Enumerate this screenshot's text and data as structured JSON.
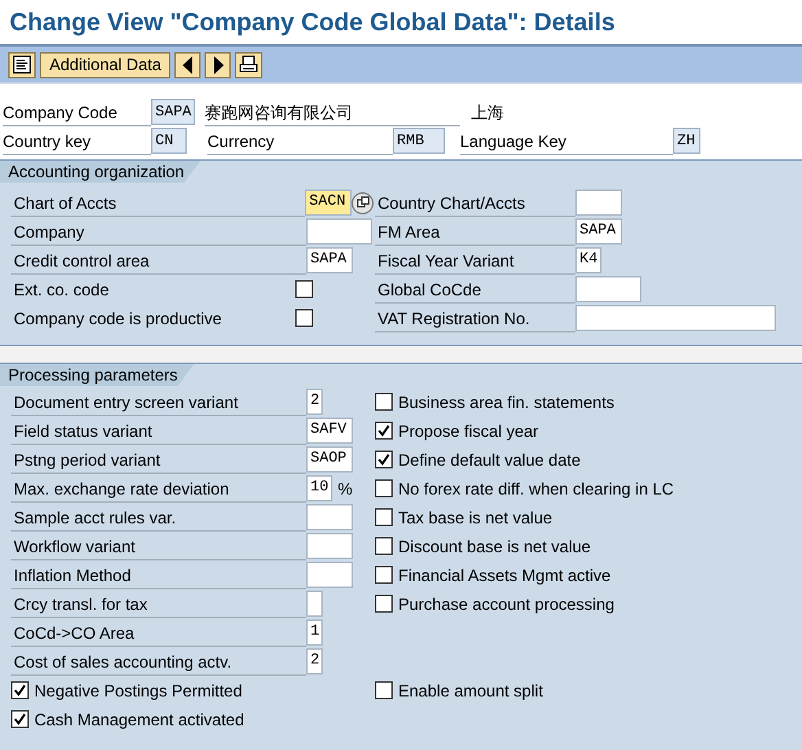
{
  "window": {
    "title": "Change View \"Company Code Global Data\": Details"
  },
  "toolbar": {
    "buttons": [
      {
        "kind": "icon"
      },
      {
        "kind": "text",
        "label": "Additional Data"
      },
      {
        "kind": "icon"
      },
      {
        "kind": "icon"
      },
      {
        "kind": "icon"
      }
    ]
  },
  "header": {
    "company_code": {
      "label": "Company Code",
      "value": "SAPA",
      "name": "赛跑网咨询有限公司",
      "city": "上海"
    },
    "country_key": {
      "label": "Country key",
      "value": "CN"
    },
    "currency": {
      "label": "Currency",
      "value": "RMB"
    },
    "language_key": {
      "label": "Language Key",
      "value": "ZH"
    }
  },
  "groups": [
    {
      "title": "Accounting organization",
      "rows": [
        {
          "left": {
            "kind": "field",
            "label": "Chart of Accts",
            "value": "SACN",
            "focused": true
          },
          "right": {
            "kind": "field",
            "label": "Country Chart/Accts"
          }
        },
        {
          "left": {
            "kind": "field",
            "label": "Company"
          },
          "right": {
            "kind": "field",
            "label": "FM Area",
            "value": "SAPA"
          }
        },
        {
          "left": {
            "kind": "field",
            "label": "Credit control area",
            "value": "SAPA"
          },
          "right": {
            "kind": "field",
            "label": "Fiscal Year Variant",
            "value": "K4"
          }
        },
        {
          "left": {
            "kind": "checkbox",
            "label": "Ext. co. code",
            "checked": false
          },
          "right": {
            "kind": "field",
            "label": "Global CoCde"
          }
        },
        {
          "left": {
            "kind": "checkbox",
            "label": "Company code is productive",
            "checked": false
          },
          "right": {
            "kind": "field",
            "label": "VAT Registration No."
          }
        }
      ]
    },
    {
      "title": "Processing parameters",
      "rows": [
        {
          "left": {
            "kind": "field",
            "label": "Document entry screen variant",
            "value": "2"
          },
          "right": {
            "kind": "check_first",
            "label": "Business area fin. statements",
            "checked": false
          }
        },
        {
          "left": {
            "kind": "field",
            "label": "Field status variant",
            "value": "SAFV"
          },
          "right": {
            "kind": "check_first",
            "label": "Propose fiscal year",
            "checked": true
          }
        },
        {
          "left": {
            "kind": "field",
            "label": "Pstng period variant",
            "value": "SAOP"
          },
          "right": {
            "kind": "check_first",
            "label": "Define default value date",
            "checked": true
          }
        },
        {
          "left": {
            "kind": "field",
            "label": "Max. exchange rate deviation",
            "value": "10",
            "unit": "%"
          },
          "right": {
            "kind": "check_first",
            "label": "No forex rate diff. when clearing in LC",
            "checked": false
          }
        },
        {
          "left": {
            "kind": "field",
            "label": "Sample acct rules var."
          },
          "right": {
            "kind": "check_first",
            "label": "Tax base is net value",
            "checked": false
          }
        },
        {
          "left": {
            "kind": "field",
            "label": "Workflow variant"
          },
          "right": {
            "kind": "check_first",
            "label": "Discount base is net value",
            "checked": false
          }
        },
        {
          "left": {
            "kind": "field",
            "label": "Inflation Method"
          },
          "right": {
            "kind": "check_first",
            "label": "Financial Assets Mgmt active",
            "checked": false
          }
        },
        {
          "left": {
            "kind": "field",
            "label": "Crcy transl. for tax"
          },
          "right": {
            "kind": "check_first",
            "label": "Purchase account processing",
            "checked": false
          }
        },
        {
          "left": {
            "kind": "field",
            "label": "CoCd->CO Area",
            "value": "1"
          }
        },
        {
          "left": {
            "kind": "field",
            "label": "Cost of sales accounting actv.",
            "value": "2"
          }
        },
        {
          "left": {
            "kind": "check_first",
            "label": "Negative Postings Permitted",
            "checked": true
          },
          "right": {
            "kind": "check_first",
            "label": "Enable amount split",
            "checked": false
          }
        },
        {
          "left": {
            "kind": "check_first",
            "label": "Cash Management activated",
            "checked": true
          }
        }
      ]
    }
  ]
}
